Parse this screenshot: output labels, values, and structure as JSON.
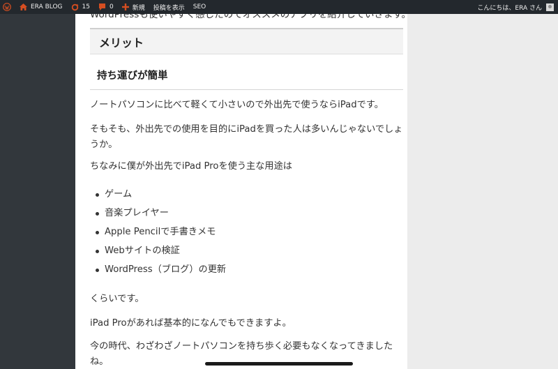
{
  "adminbar": {
    "site_name": "ERA BLOG",
    "updates_count": "15",
    "comments_count": "0",
    "new_label": "新規",
    "view_post_label": "投稿を表示",
    "seo_label": "SEO",
    "greeting": "こんにちは、ERA さん"
  },
  "article": {
    "cut_top_line": "WordPressも使いやすく感じたのでオススメのアプリを紹介していきます。",
    "heading_h2": "メリット",
    "heading_h3": "持ち運びが簡単",
    "para1": "ノートパソコンに比べて軽くて小さいので外出先で使うならiPadです。",
    "para2": "そもそも、外出先での使用を目的にiPadを買った人は多いんじゃないでしょうか。",
    "para3": "ちなみに僕が外出先でiPad Proを使う主な用途は",
    "list": [
      "ゲーム",
      "音楽プレイヤー",
      "Apple Pencilで手書きメモ",
      "Webサイトの検証",
      "WordPress（ブログ）の更新"
    ],
    "para4": "くらいです。",
    "para5": "iPad Proがあれば基本的になんでもできますよ。",
    "para6": "今の時代、わざわざノートパソコンを持ち歩く必要もなくなってきましたね。"
  },
  "colors": {
    "adminbar_bg": "#23282d",
    "sidebar_bg": "#32373c",
    "accent_red": "#d54e21"
  }
}
